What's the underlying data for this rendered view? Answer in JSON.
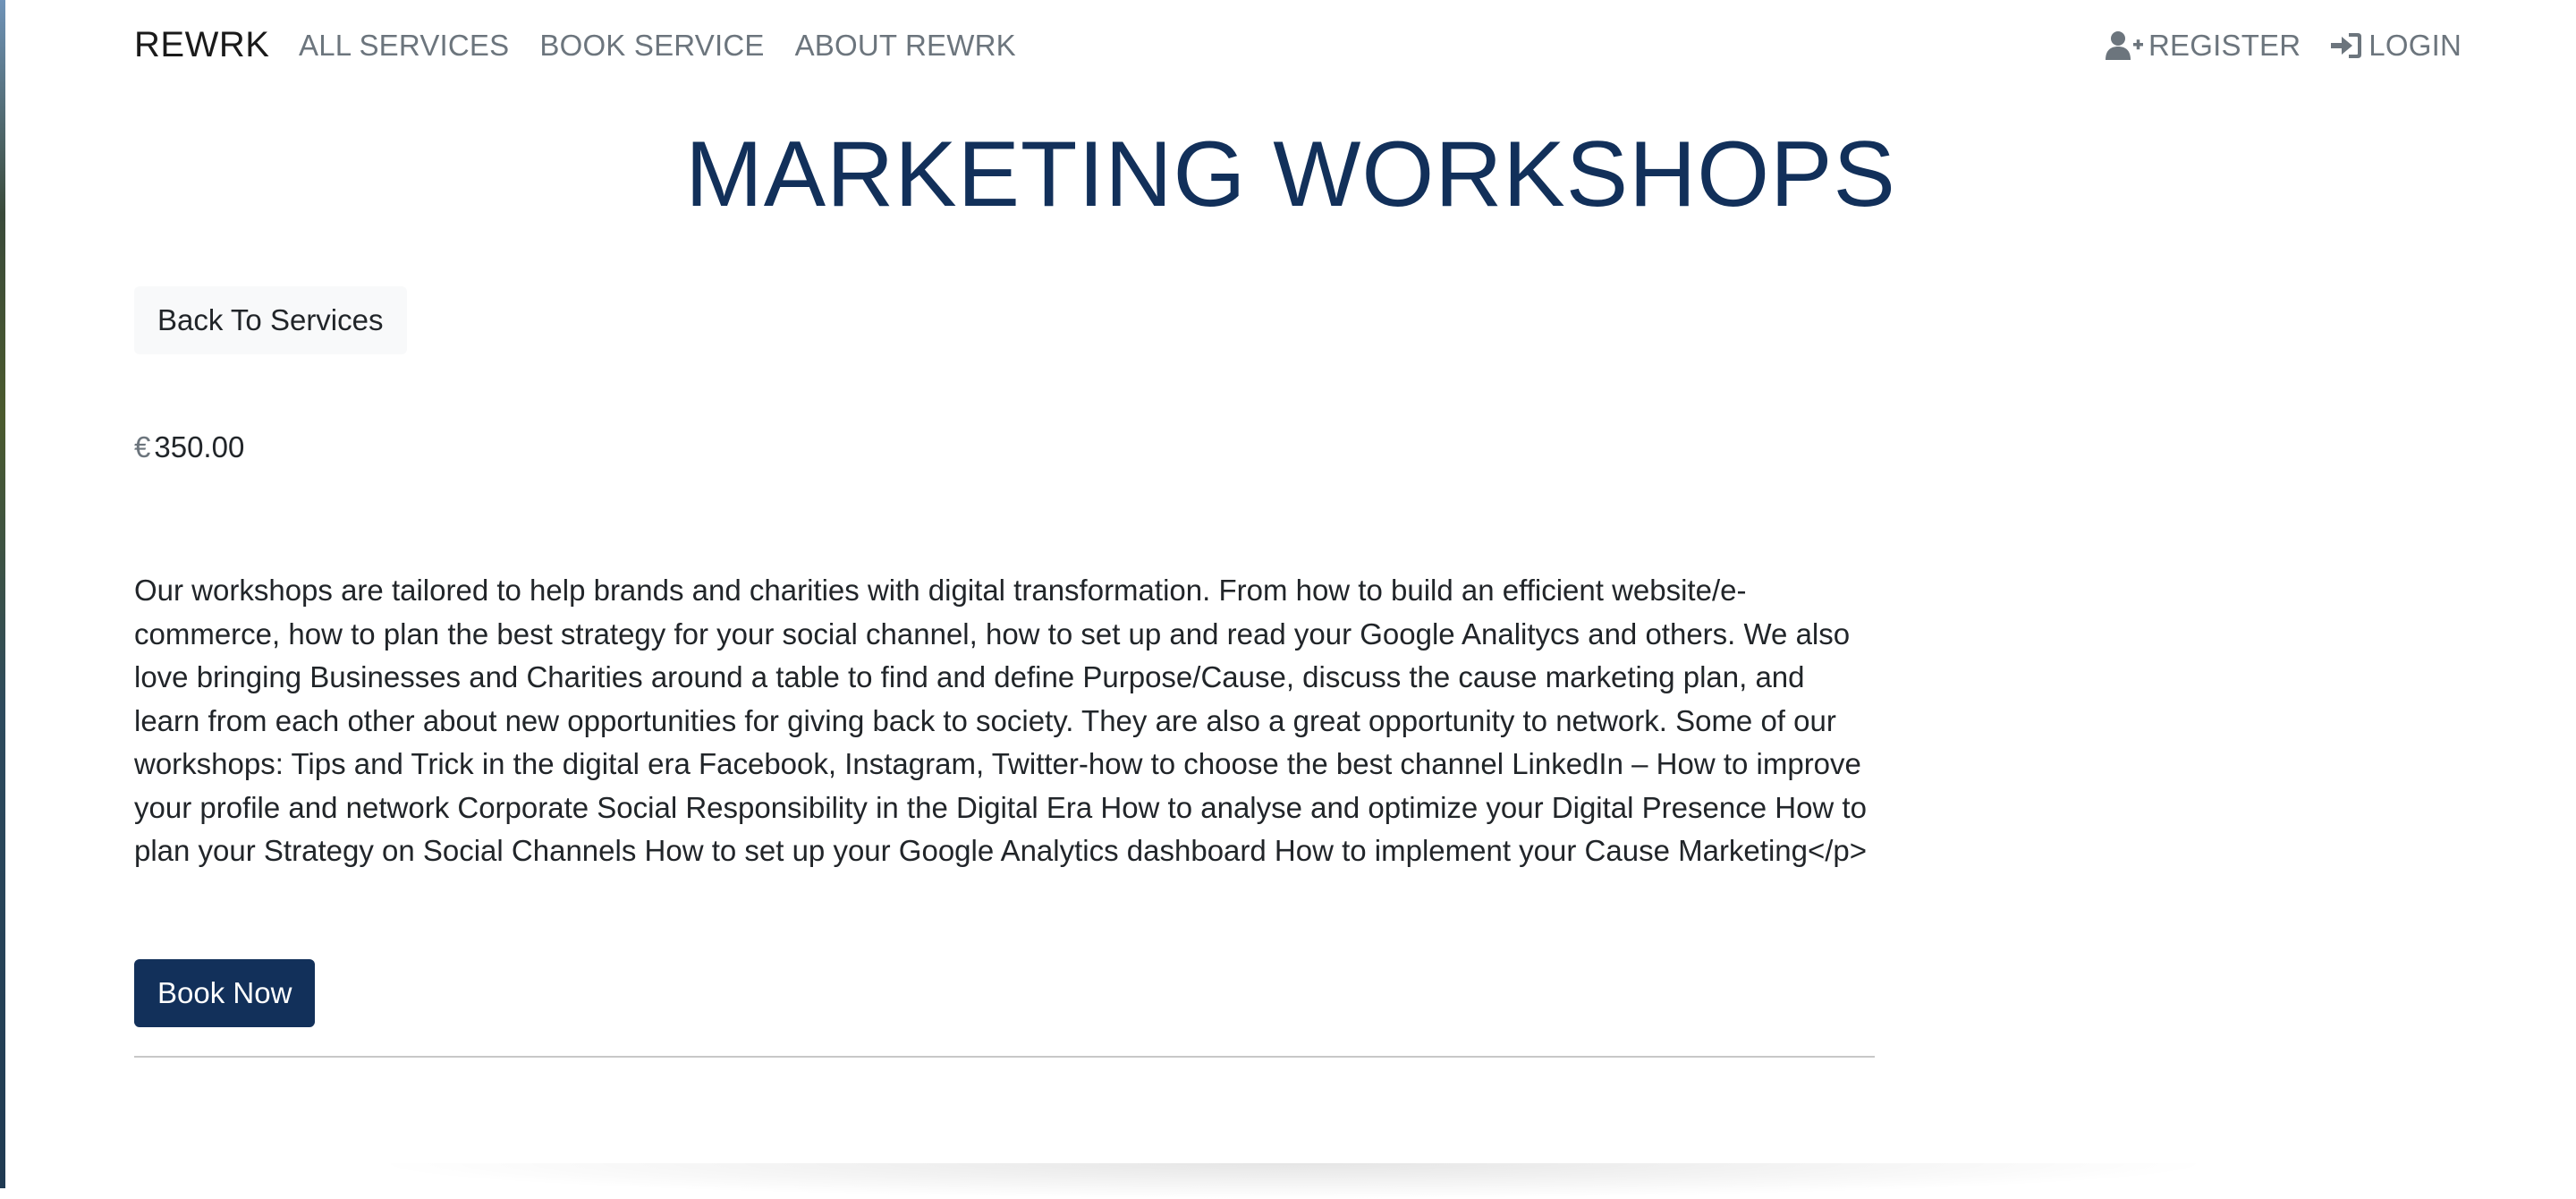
{
  "navbar": {
    "brand": "REWRK",
    "links": [
      {
        "label": "ALL SERVICES"
      },
      {
        "label": "BOOK SERVICE"
      },
      {
        "label": "ABOUT REWRK"
      }
    ],
    "register_label": "REGISTER",
    "login_label": "LOGIN",
    "register_icon": "user-plus-icon",
    "login_icon": "sign-in-icon"
  },
  "main": {
    "title": "MARKETING WORKSHOPS",
    "back_button_label": "Back To Services",
    "price_currency_icon": "euro-icon",
    "price_currency_symbol": "€",
    "price_value": "350.00",
    "description": "Our workshops are tailored to help brands and charities with digital transformation. From how to build an efficient website/e-commerce, how to plan the best strategy for your social channel, how to set up and read your Google Analitycs and others. We also love bringing Businesses and Charities around a table to find and define Purpose/Cause, discuss the cause marketing plan, and learn from each other about new opportunities for giving back to society. They are also a great opportunity to network. Some of our workshops: Tips and Trick in the digital era Facebook, Instagram, Twitter-how to choose the best channel LinkedIn – How to improve your profile and network Corporate Social Responsibility in the Digital Era How to analyse and optimize your Digital Presence How to plan your Strategy on Social Channels How to set up your Google Analytics dashboard How to implement your Cause Marketing</p>",
    "book_button_label": "Book Now"
  },
  "colors": {
    "primary": "#12305a",
    "nav_text": "#6c757d",
    "body_text": "#212529",
    "back_button_bg": "#f8f9fa"
  }
}
